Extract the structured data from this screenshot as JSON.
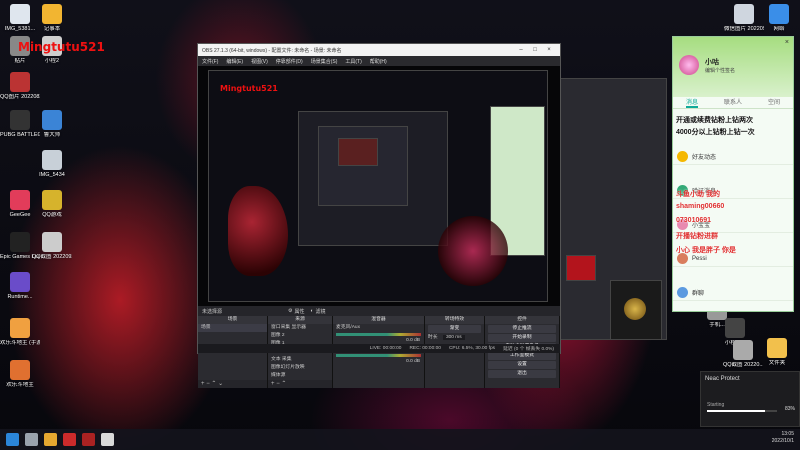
{
  "desktop": {
    "icons_left": [
      {
        "label": "IMG_5381...",
        "color": "#dfe6ee"
      },
      {
        "label": "记事本",
        "color": "#f2b531"
      },
      {
        "label": "贴片",
        "color": "#888888"
      },
      {
        "label": "小程2",
        "color": "#cfcfcf"
      },
      {
        "label": "QQ图片 20220823...",
        "color": "#bb3333"
      },
      {
        "label": "PUBG BATTLEGR...",
        "color": "#333333"
      },
      {
        "label": "鲁大师",
        "color": "#3b84d6"
      },
      {
        "label": "IMG_5434",
        "color": "#c8d0d8"
      },
      {
        "label": "GeeGee",
        "color": "#e23c5a"
      },
      {
        "label": "QQ游戏",
        "color": "#d6b32c"
      },
      {
        "label": "Epic Games Launcher",
        "color": "#222222"
      },
      {
        "label": "QQ截图 20220926...",
        "color": "#cccccc"
      },
      {
        "label": "Runtime...",
        "color": "#6a4cc9"
      },
      {
        "label": "欢乐斗地主 (手游电脑版)",
        "color": "#f0a040"
      },
      {
        "label": "欢乐斗地主",
        "color": "#e07030"
      }
    ],
    "icons_right": [
      {
        "label": "微信图片 2022092...",
        "color": "#cfd6df"
      },
      {
        "label": "网络",
        "color": "#3a8ee8"
      },
      {
        "label": "工作台...",
        "color": "#3b7fd4"
      },
      {
        "label": "手机...",
        "color": "#999999"
      },
      {
        "label": "小程222",
        "color": "#444444"
      },
      {
        "label": "文件夹",
        "color": "#f2c04c"
      },
      {
        "label": "QQ截图 20220...",
        "color": "#aaaaaa"
      }
    ],
    "watermark": "Mingtutu521",
    "watermark_color": "#ee1111"
  },
  "obs": {
    "title": "OBS 27.1.3 (64-bit, windows) - 配置文件: 未命名 - 场景: 未命名",
    "menu": [
      "文件(F)",
      "编辑(E)",
      "视图(V)",
      "停靠部件(D)",
      "场景集合(S)",
      "工具(T)",
      "帮助(H)"
    ],
    "preview_label": "Mingtutu521",
    "no_source": "未选择源",
    "props_button": "属性",
    "filters_button": "滤镜",
    "docks": {
      "scenes": {
        "header": "场景",
        "items": [
          "场景"
        ]
      },
      "sources": {
        "header": "来源",
        "items": [
          "窗口采集 显示器",
          "图像 2",
          "图像 1",
          "文本 (GDI+)",
          "文本 采集",
          "图像幻灯片放映",
          "媒体源"
        ]
      },
      "mixer": {
        "header": "混音器",
        "channels": [
          {
            "name": "麦克风/Aux",
            "db": "0.0 dB"
          },
          {
            "name": "桌面音频",
            "db": "0.0 dB"
          }
        ]
      },
      "transitions": {
        "header": "转场特效",
        "type": "渐变",
        "duration_label": "时长",
        "duration": "300 ms"
      },
      "controls": {
        "header": "控件",
        "buttons": [
          "停止推流",
          "开始录制",
          "启动虚拟摄像机",
          "工作室模式",
          "设置",
          "退出"
        ]
      }
    },
    "status": {
      "live": "LIVE: 00:00:00",
      "rec": "REC: 00:00:00",
      "cpu": "CPU: 6.5%, 30.00 fps",
      "delay": "延迟 (0 个 帧丢失 0.0%)"
    }
  },
  "qq": {
    "username": "小咕",
    "signature": "编辑个性签名",
    "tabs": [
      "消息",
      "联系人",
      "空间"
    ],
    "items": [
      {
        "name": "好友动态",
        "color": "#f5b800"
      },
      {
        "name": "验证消息",
        "color": "#33aa77"
      },
      {
        "name": "小宝宝",
        "color": "#e88ab0"
      },
      {
        "name": "Pessi",
        "color": "#d97d5d"
      },
      {
        "name": "群聊",
        "color": "#5c9ae0"
      }
    ],
    "danmu": [
      {
        "text": "开通或续费钻粉上钻两次",
        "color": "#111111"
      },
      {
        "text": "4000分以上钻粉上钻一次",
        "color": "#111111"
      },
      {
        "text": "斗鱼小助 我的",
        "color": "#e03030"
      },
      {
        "text": "shaming00660",
        "color": "#e03030"
      },
      {
        "text": "073010691",
        "color": "#e03030"
      },
      {
        "text": "开播钻粉进群",
        "color": "#e03030"
      },
      {
        "text": "小心 我是胖子 你是",
        "color": "#e03030"
      }
    ]
  },
  "toast": {
    "title": "Neac Protect",
    "status": "Starting",
    "percent": "83%",
    "progress": 0.83
  },
  "taskbar": {
    "icons": [
      {
        "color": "#2b86d9"
      },
      {
        "color": "#9aa3ad"
      },
      {
        "color": "#e6a830"
      },
      {
        "color": "#cc2b2b"
      },
      {
        "color": "#aa2222"
      },
      {
        "color": "#d9d9d9"
      }
    ],
    "time": "13:05",
    "date": "2022/10/1"
  }
}
